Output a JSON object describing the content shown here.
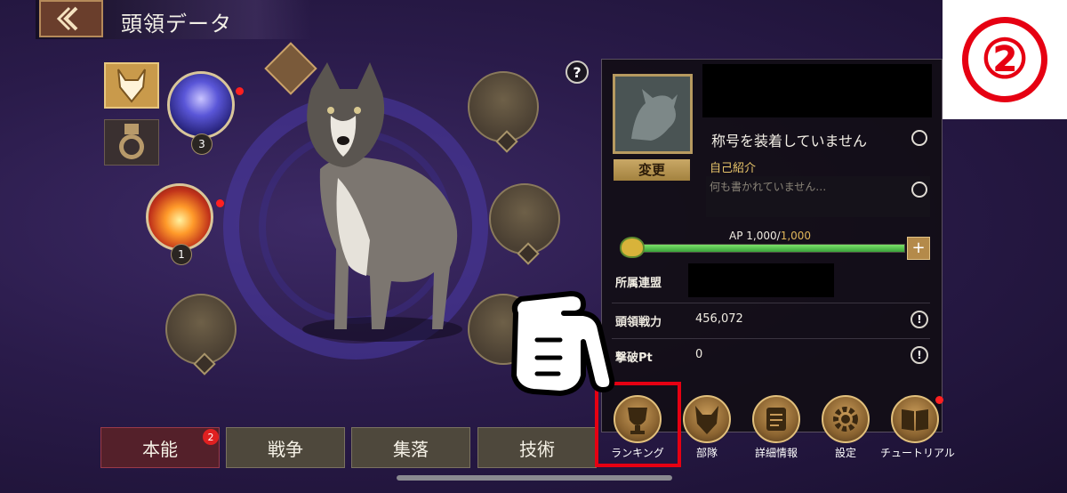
{
  "header": {
    "title": "頭領データ"
  },
  "step_badge": {
    "label": "②"
  },
  "skills": [
    {
      "level": "3"
    },
    {
      "level": "1"
    }
  ],
  "profile": {
    "change_label": "変更",
    "title_text": "称号を装着していません",
    "intro_label": "自己紹介",
    "intro_text": "何も書かれていません…",
    "ap": {
      "prefix": "AP",
      "current": "1,000",
      "max": "1,000",
      "fraction": 1.0
    },
    "rows": [
      {
        "label": "所属連盟",
        "value": ""
      },
      {
        "label": "頭領戦力",
        "value": "456,072"
      },
      {
        "label": "撃破Pt",
        "value": "0"
      }
    ]
  },
  "tabs": [
    {
      "label": "本能",
      "badge": "2"
    },
    {
      "label": "戦争"
    },
    {
      "label": "集落"
    },
    {
      "label": "技術"
    }
  ],
  "actions": [
    {
      "label": "ランキング",
      "icon": "trophy-icon"
    },
    {
      "label": "部隊",
      "icon": "wolf-head-icon"
    },
    {
      "label": "詳細情報",
      "icon": "scroll-icon"
    },
    {
      "label": "設定",
      "icon": "gear-icon"
    },
    {
      "label": "チュートリアル",
      "icon": "book-icon"
    }
  ],
  "colors": {
    "accent_gold": "#c99a4b",
    "highlight_red": "#e60012",
    "ap_green": "#4fc04a",
    "background_purple": "#2a1b4a"
  }
}
